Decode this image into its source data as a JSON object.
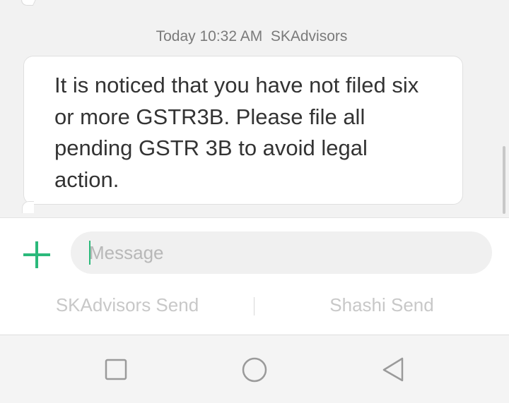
{
  "conversation": {
    "timestamp": "Today 10:32 AM  SKAdvisors",
    "message": "It is noticed that you have not filed six or more GSTR3B. Please file all pending GSTR 3B to avoid legal action."
  },
  "compose": {
    "add_icon": "plus-icon",
    "placeholder": "Message",
    "value": "",
    "send_sim1_label": "SKAdvisors Send",
    "send_sim2_label": "Shashi Send"
  },
  "navbar": {
    "recent_icon": "square-icon",
    "home_icon": "circle-icon",
    "back_icon": "triangle-back-icon"
  },
  "colors": {
    "accent": "#2bb97b",
    "background": "#f2f2f2",
    "bubble": "#ffffff",
    "text": "#333333",
    "muted": "#c8c8c8"
  }
}
